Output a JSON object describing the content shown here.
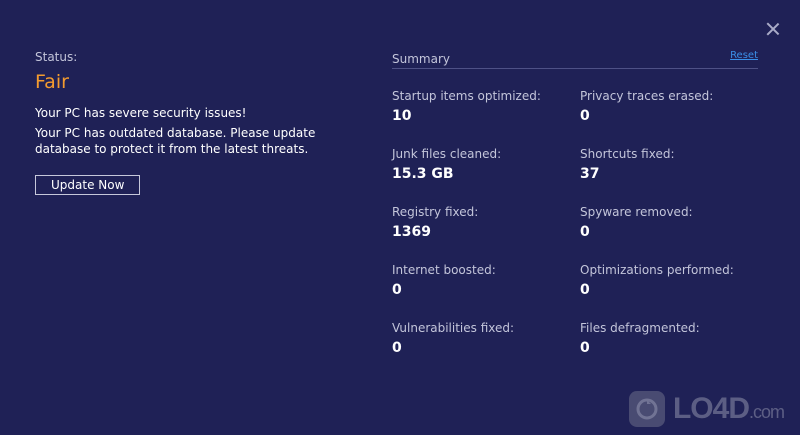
{
  "status": {
    "label": "Status:",
    "value": "Fair",
    "message_security": "Your PC has severe security issues!",
    "message_database": "Your PC has outdated database. Please update database to protect it from the latest threats.",
    "update_button": "Update Now"
  },
  "summary": {
    "title": "Summary",
    "reset_label": "Reset",
    "items": [
      {
        "label": "Startup items optimized:",
        "value": "10"
      },
      {
        "label": "Privacy traces erased:",
        "value": "0"
      },
      {
        "label": "Junk files cleaned:",
        "value": "15.3 GB"
      },
      {
        "label": "Shortcuts fixed:",
        "value": "37"
      },
      {
        "label": "Registry fixed:",
        "value": "1369"
      },
      {
        "label": "Spyware removed:",
        "value": "0"
      },
      {
        "label": "Internet boosted:",
        "value": "0"
      },
      {
        "label": "Optimizations performed:",
        "value": "0"
      },
      {
        "label": "Vulnerabilities fixed:",
        "value": "0"
      },
      {
        "label": "Files defragmented:",
        "value": "0"
      }
    ]
  },
  "watermark": {
    "text": "LO4D",
    "suffix": ".com"
  },
  "colors": {
    "background": "#1f2156",
    "status_fair": "#f39b2f",
    "link": "#3a8fe8"
  },
  "icons": {
    "close": "close-icon",
    "watermark_logo": "lo4d-logo-icon"
  }
}
